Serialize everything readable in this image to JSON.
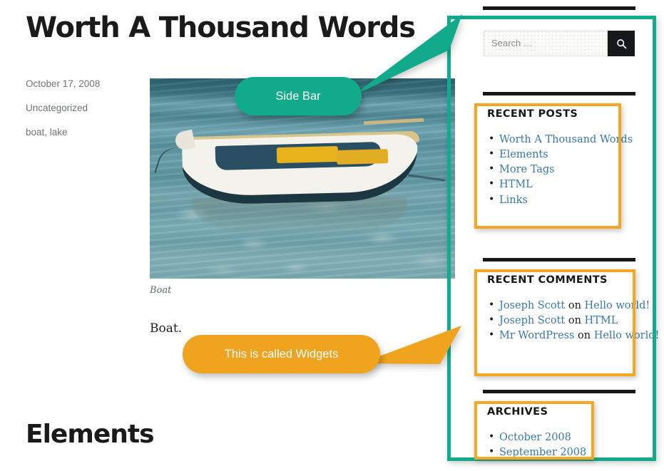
{
  "post": {
    "title": "Worth A Thousand Words",
    "meta": [
      "October 17, 2008",
      "Uncategorized",
      "boat, lake"
    ],
    "image_caption": "Boat",
    "body": "Boat.",
    "next_section_title": "Elements"
  },
  "callouts": [
    {
      "id": "sidebar-callout",
      "label": "Side Bar",
      "color": "#11ab8b"
    },
    {
      "id": "widgets-callout",
      "label": "This is called Widgets",
      "color": "#f0a31e"
    }
  ],
  "sidebar": {
    "search": {
      "placeholder": "Search …",
      "value": "",
      "button_icon": "search-icon"
    },
    "widgets": [
      {
        "title": "RECENT POSTS",
        "items": [
          {
            "text": "Worth A Thousand Words",
            "link": true
          },
          {
            "text": "Elements",
            "link": true
          },
          {
            "text": "More Tags",
            "link": true
          },
          {
            "text": "HTML",
            "link": true
          },
          {
            "text": "Links",
            "link": true
          }
        ]
      },
      {
        "title": "RECENT COMMENTS",
        "items": [
          {
            "author": "Joseph Scott",
            "on": "on",
            "post": "Hello world!"
          },
          {
            "author": "Joseph Scott",
            "on": "on",
            "post": "HTML"
          },
          {
            "author": "Mr WordPress",
            "on": "on",
            "post": "Hello world!"
          }
        ]
      },
      {
        "title": "ARCHIVES",
        "items": [
          {
            "text": "October 2008",
            "link": true
          },
          {
            "text": "September 2008",
            "link": true
          }
        ]
      }
    ]
  },
  "colors": {
    "teal_highlight": "#12ab8e",
    "orange_highlight": "#f5a623",
    "link_blue": "#3878ab",
    "heading_black": "#1a1a1a",
    "meta_gray": "#6f7671"
  }
}
